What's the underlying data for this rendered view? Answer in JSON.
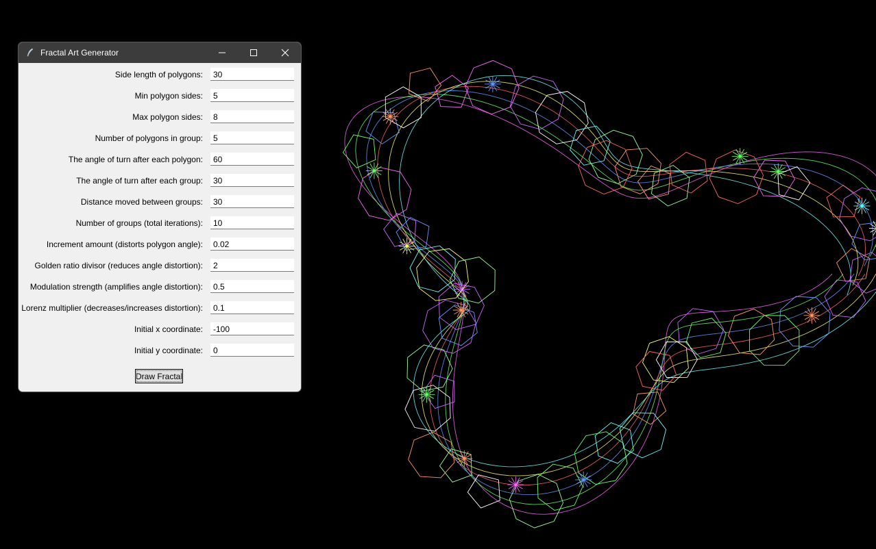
{
  "window": {
    "title": "Fractal Art Generator",
    "controls": {
      "minimize": "minimize-icon",
      "maximize": "maximize-icon",
      "close": "close-icon"
    }
  },
  "fields": [
    {
      "label": "Side length of polygons:",
      "value": "30"
    },
    {
      "label": "Min polygon sides:",
      "value": "5"
    },
    {
      "label": "Max polygon sides:",
      "value": "8"
    },
    {
      "label": "Number of polygons in group:",
      "value": "5"
    },
    {
      "label": "The angle of turn after each polygon:",
      "value": "60"
    },
    {
      "label": "The angle of turn after each group:",
      "value": "30"
    },
    {
      "label": "Distance moved between groups:",
      "value": "30"
    },
    {
      "label": "Number of groups (total iterations):",
      "value": "10"
    },
    {
      "label": "Increment amount (distorts polygon angle):",
      "value": "0.02"
    },
    {
      "label": "Golden ratio divisor (reduces angle distortion):",
      "value": "2"
    },
    {
      "label": "Modulation strength (amplifies angle distortion):",
      "value": "0.5"
    },
    {
      "label": "Lorenz multiplier (decreases/increases distortion):",
      "value": "0.1"
    },
    {
      "label": "Initial x coordinate:",
      "value": "-100"
    },
    {
      "label": "Initial y coordinate:",
      "value": "0"
    }
  ],
  "draw_button": "Draw Fractal",
  "canvas": {
    "background": "#000000",
    "palette": [
      "#ff66ff",
      "#66ff66",
      "#6699ff",
      "#ff6666",
      "#ffff66",
      "#66ffff",
      "#ffffff",
      "#cc66ff",
      "#99ff99",
      "#ff9966"
    ]
  }
}
